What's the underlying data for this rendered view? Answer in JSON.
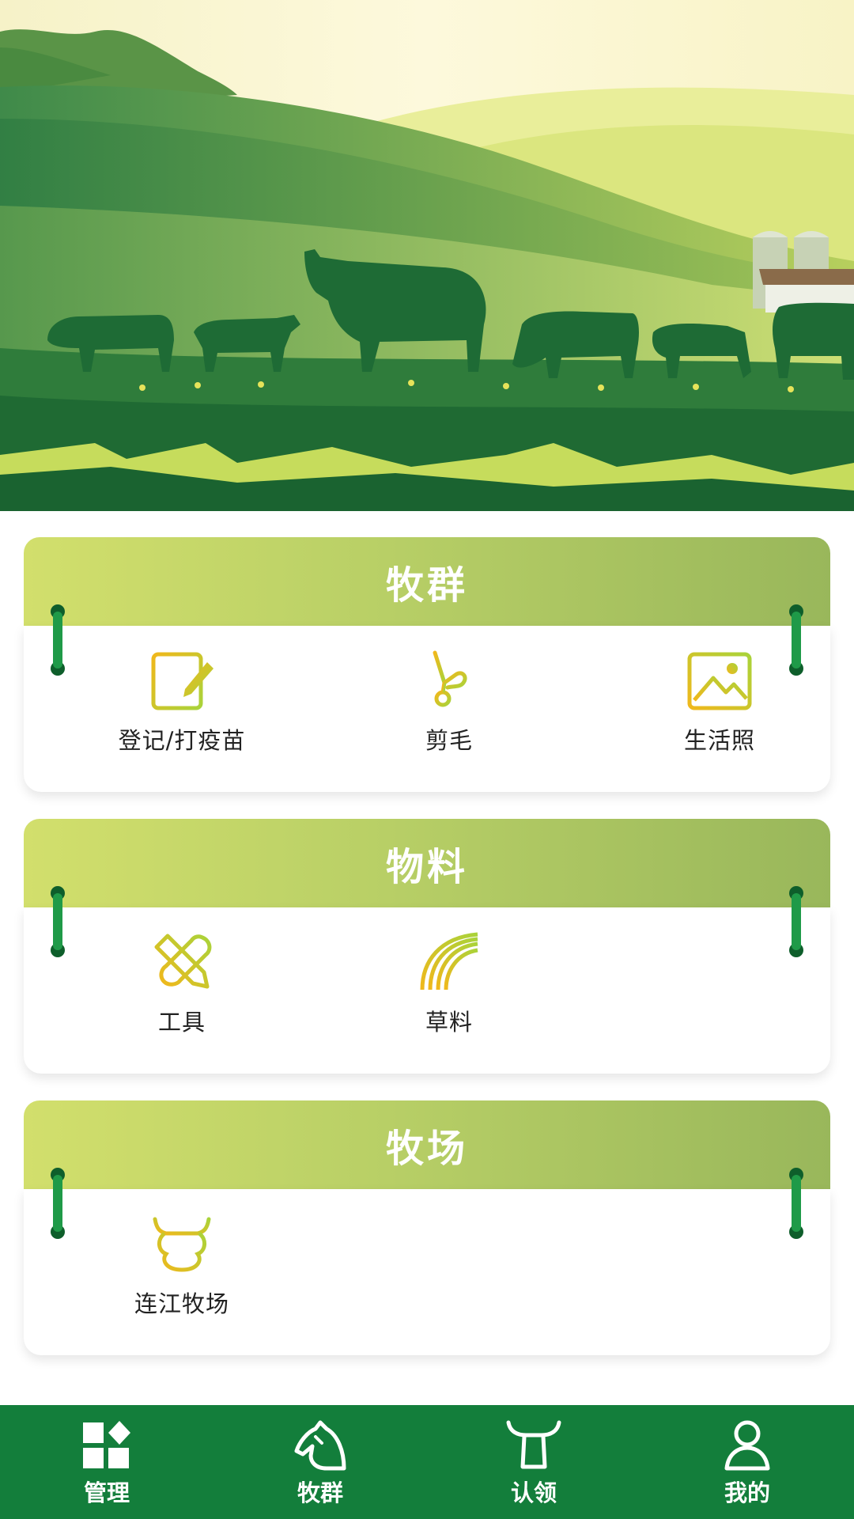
{
  "hero": {
    "image": "pasture-with-cattle-illustration"
  },
  "sections": [
    {
      "title": "牧群",
      "items": [
        {
          "label": "登记/打疫苗",
          "icon": "register-edit-icon"
        },
        {
          "label": "剪毛",
          "icon": "scissors-icon"
        },
        {
          "label": "生活照",
          "icon": "photo-icon"
        }
      ]
    },
    {
      "title": "物料",
      "items": [
        {
          "label": "工具",
          "icon": "tools-icon"
        },
        {
          "label": "草料",
          "icon": "hay-icon"
        }
      ]
    },
    {
      "title": "牧场",
      "items": [
        {
          "label": "连江牧场",
          "icon": "cow-head-icon"
        }
      ]
    }
  ],
  "tabbar": [
    {
      "label": "管理",
      "icon": "grid-manage-icon"
    },
    {
      "label": "牧群",
      "icon": "horse-head-icon"
    },
    {
      "label": "认领",
      "icon": "bull-horns-icon"
    },
    {
      "label": "我的",
      "icon": "user-icon"
    }
  ],
  "colors": {
    "primary_green": "#137e3b",
    "header_gradient_start": "#d2df6c",
    "header_gradient_end": "#99b75b",
    "icon_yellow": "#e9c01d",
    "icon_green": "#9fcf37"
  }
}
